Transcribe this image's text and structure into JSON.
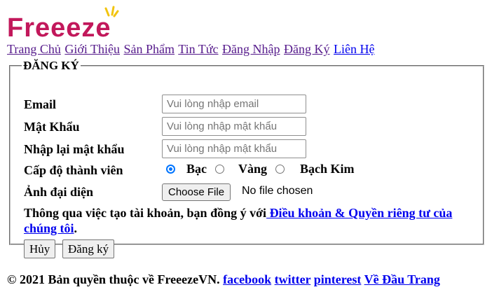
{
  "logo": {
    "text": "Freeeze",
    "color": "#c2185b",
    "spark_color": "#f2c40f"
  },
  "nav": {
    "items": [
      "Trang Chủ",
      "Giới Thiệu",
      "Sản Phẩm",
      "Tin Tức",
      "Đăng Nhập",
      "Đăng Ký",
      "Liên Hệ"
    ]
  },
  "form": {
    "legend": "ĐĂNG KÝ",
    "email_label": "Email",
    "email_placeholder": "Vui lòng nhập email",
    "password_label": "Mật Khẩu",
    "password_placeholder": "Vui lòng nhập mật khẩu",
    "confirm_label": "Nhập lại mật khẩu",
    "confirm_placeholder": "Vui lòng nhập mật khẩu",
    "level_label": "Cấp độ thành viên",
    "levels": [
      "Bạc",
      "Vàng",
      "Bạch Kim"
    ],
    "selected_level": "Bạc",
    "avatar_label": "Ảnh đại diện",
    "file_button": "Choose File",
    "file_status": "No file chosen",
    "terms_prefix": "Thông qua việc tạo tài khoản, bạn đồng ý với",
    "terms_link": " Điều khoản & Quyền riêng tư của chúng tôi",
    "terms_suffix": ".",
    "cancel_button": "Hủy",
    "submit_button": "Đăng ký"
  },
  "footer": {
    "copyright": "© 2021 Bản quyền thuộc về FreeezeVN.",
    "links": [
      "facebook",
      "twitter",
      "pinterest",
      "Về Đầu Trang"
    ]
  }
}
